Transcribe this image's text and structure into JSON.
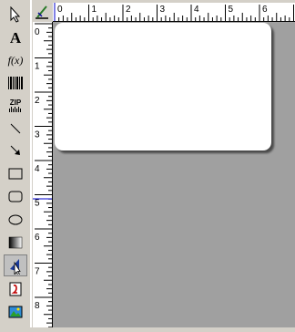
{
  "toolbar": {
    "tools": [
      {
        "name": "select-pointer-icon"
      },
      {
        "name": "text-tool-icon",
        "label": "A"
      },
      {
        "name": "formula-tool-icon",
        "label": "f(x)"
      },
      {
        "name": "barcode-tool-icon"
      },
      {
        "name": "zip-barcode-tool-icon",
        "label": "ZIP"
      },
      {
        "name": "line-tool-icon"
      },
      {
        "name": "arrow-tool-icon"
      },
      {
        "name": "rectangle-tool-icon"
      },
      {
        "name": "rounded-rectangle-tool-icon"
      },
      {
        "name": "ellipse-tool-icon"
      },
      {
        "name": "gradient-tool-icon"
      },
      {
        "name": "triangle-tool-icon"
      },
      {
        "name": "image-tool-icon"
      },
      {
        "name": "picture-tool-icon"
      }
    ]
  },
  "rulers": {
    "horizontal_labels": [
      "0",
      "1",
      "2",
      "3",
      "4",
      "5",
      "6"
    ],
    "vertical_labels": [
      "0",
      "1",
      "2",
      "3",
      "4",
      "5",
      "6",
      "7",
      "8"
    ]
  },
  "colors": {
    "workspace": "#a0a0a0",
    "label_background": "#ffffff",
    "toolbar": "#d4d0c8",
    "ruler_marker": "#0000cc"
  }
}
